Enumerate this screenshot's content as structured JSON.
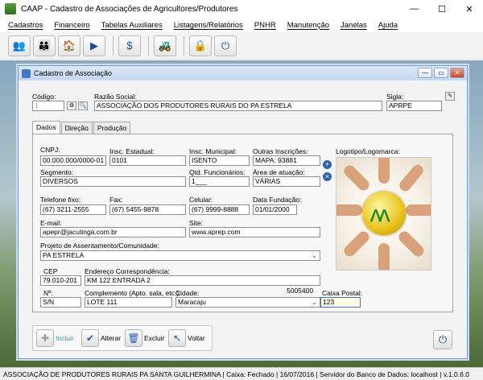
{
  "app": {
    "title": "CAAP - Cadastro de Associações de Agricultores/Produtores",
    "window_controls": {
      "minimize": "—",
      "maximize": "☐",
      "close": "✕"
    }
  },
  "menu": [
    "Cadastros",
    "Financeiro",
    "Tabelas Auxiliares",
    "Listagens/Relatórios",
    "PNHR",
    "Manutenção",
    "Janelas",
    "Ajuda"
  ],
  "toolbar_icons": [
    "people-icon",
    "group-icon",
    "farm-icon",
    "play-icon",
    "dollar-icon",
    "tractor-icon",
    "lock-icon",
    "power-icon"
  ],
  "toolbar_glyphs": {
    "people": "👥",
    "group": "👪",
    "farm": "🏠",
    "play": "▶",
    "dollar": "$",
    "tractor": "🚜",
    "lock": "🔒",
    "power": "⏻"
  },
  "form": {
    "title": "Cadastro de Associação",
    "controls": {
      "minimize": "—",
      "restore": "▭",
      "close": "✕"
    },
    "codigo_label": "Código:",
    "codigo_value": "1",
    "razao_label": "Razão Social:",
    "razao_value": "ASSOCIAÇÃO DOS PRODUTORES RURAIS DO PA ESTRELA",
    "sigla_label": "Sigla:",
    "sigla_value": "APRPE",
    "tabs": [
      "Dados",
      "Direção",
      "Produção"
    ],
    "cnpj_label": "CNPJ:",
    "cnpj_value": "00.000.000/0000-01",
    "insc_est_label": "Insc. Estadual:",
    "insc_est_value": "0101",
    "insc_mun_label": "Insc. Municipal:",
    "insc_mun_value": "ISENTO",
    "outras_label": "Outras Inscrições:",
    "outras_value": "MAPA: 93881",
    "logo_label": "Logotipo/Logomarca:",
    "segmento_label": "Segmento:",
    "segmento_value": "DIVERSOS",
    "qtd_label": "Qtd. Funcionários:",
    "qtd_value": "1___",
    "area_label": "Área de atuação:",
    "area_value": "VÁRIAS",
    "tel_label": "Telefone fixo:",
    "tel_value": "(67) 3211-2555",
    "fax_label": "Fax:",
    "fax_value": "(67) 5455-9878",
    "cel_label": "Celular:",
    "cel_value": "(67) 9999-8888",
    "fund_label": "Data Fundação:",
    "fund_value": "01/01/2000",
    "email_label": "E-mail:",
    "email_value": "apepr@jacutinga.com.br",
    "site_label": "Site:",
    "site_value": "www.aprep.com",
    "projeto_label": "Projeto de Assentamento/Comunidade:",
    "projeto_value": "PA ESTRELA",
    "cep_label": "CEP",
    "cep_value": "79.010-201",
    "end_label": "Endereço Correspondência:",
    "end_value": "KM 122 ENTRADA 2",
    "num_label": "Nº:",
    "num_value": "S/N",
    "compl_label": "Complemento (Apto. sala, etc.):",
    "compl_value": "LOTE 111",
    "cidade_label": "Cidade:",
    "cidade_code": "5005400",
    "cidade_value": "Maracaju",
    "caixa_label": "Caixa Postal:",
    "caixa_value": "123",
    "actions": {
      "incluir": "Incluir",
      "alterar": "Alterar",
      "excluir": "Excluir",
      "voltar": "Voltar"
    },
    "action_glyphs": {
      "incluir": "✚",
      "alterar": "✔",
      "excluir": "🗑",
      "voltar": "↖"
    },
    "power_glyph": "⏻",
    "dropdown_glyph": "⌄",
    "add_glyph": "+",
    "remove_glyph": "×"
  },
  "status": "ASSOCIAÇÃO DE PRODUTORES RURAIS PA SANTA GUILHERMINA  |  Caixa: Fechado  |  16/07/2016  |  Servidor do Banco de Dados: localhost  |  v.1.0.6.0"
}
